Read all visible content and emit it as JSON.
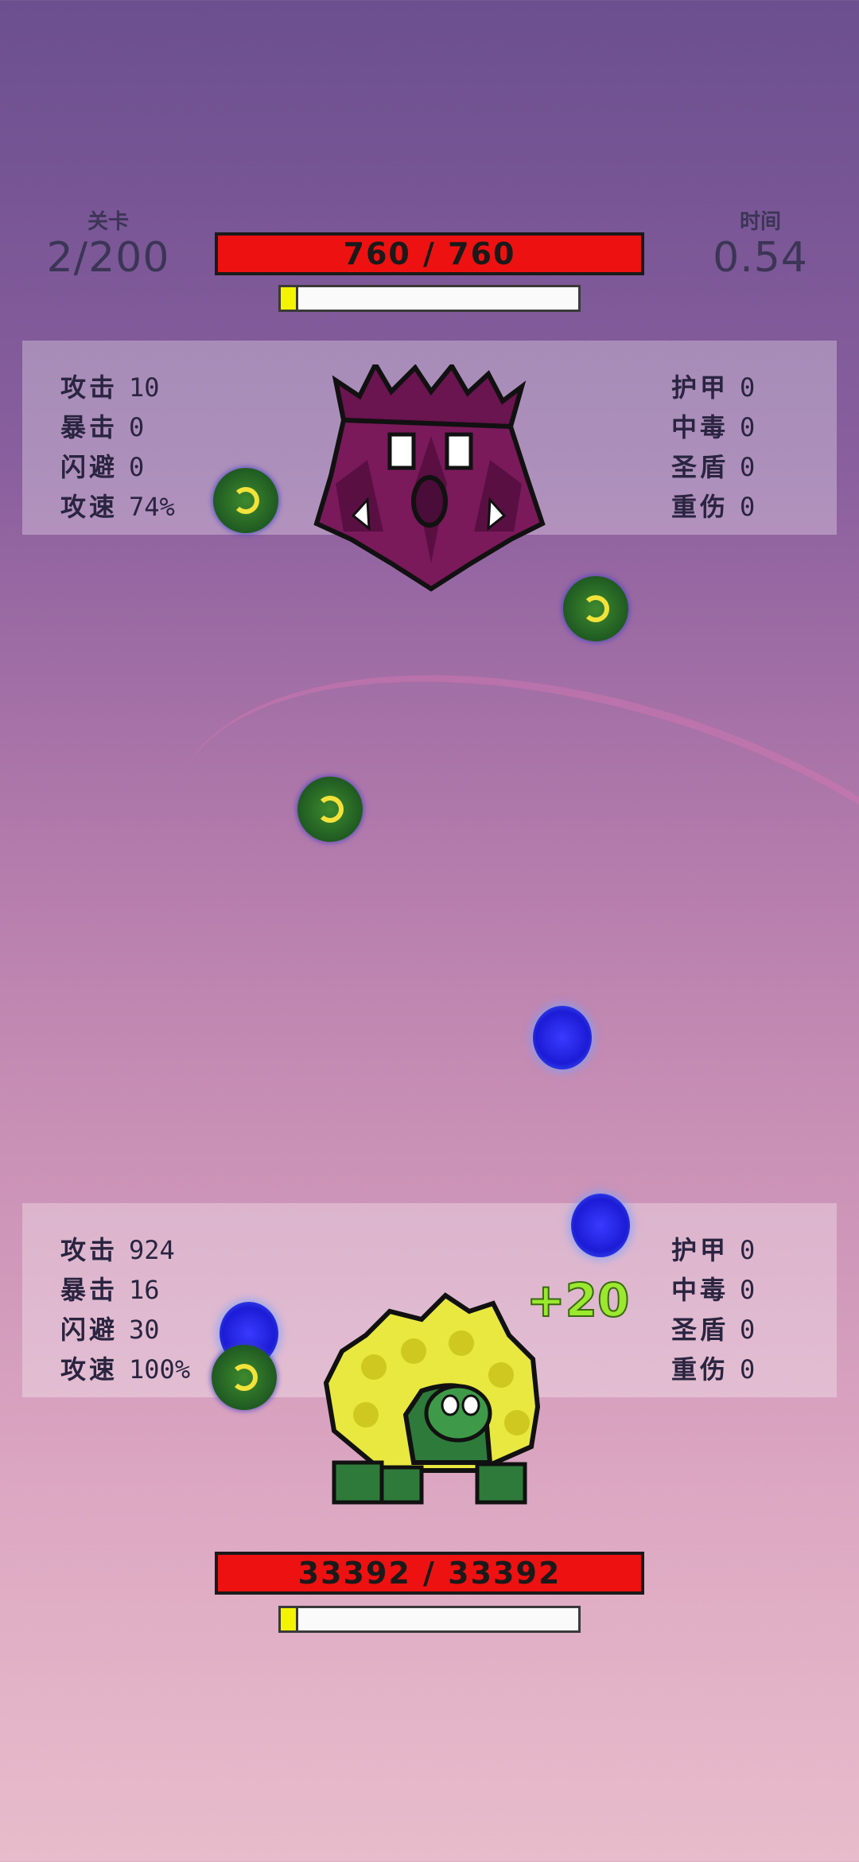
{
  "hud": {
    "level_label": "关卡",
    "level_value": "2/200",
    "time_label": "时间",
    "time_value": "0.54"
  },
  "enemy": {
    "hp_text": "760 / 760",
    "hp_fraction": 1.0,
    "charge_fraction": 0.05,
    "stats_left": [
      {
        "label": "攻击",
        "value": "10"
      },
      {
        "label": "暴击",
        "value": "0"
      },
      {
        "label": "闪避",
        "value": "0"
      },
      {
        "label": "攻速",
        "value": "74%"
      }
    ],
    "stats_right": [
      {
        "label": "护甲",
        "value": "0"
      },
      {
        "label": "中毒",
        "value": "0"
      },
      {
        "label": "圣盾",
        "value": "0"
      },
      {
        "label": "重伤",
        "value": "0"
      }
    ]
  },
  "player": {
    "hp_text": "33392 / 33392",
    "hp_fraction": 1.0,
    "charge_fraction": 0.05,
    "heal_popup": "+20",
    "stats_left": [
      {
        "label": "攻击",
        "value": "924"
      },
      {
        "label": "暴击",
        "value": "16"
      },
      {
        "label": "闪避",
        "value": "30"
      },
      {
        "label": "攻速",
        "value": "100%"
      }
    ],
    "stats_right": [
      {
        "label": "护甲",
        "value": "0"
      },
      {
        "label": "中毒",
        "value": "0"
      },
      {
        "label": "圣盾",
        "value": "0"
      },
      {
        "label": "重伤",
        "value": "0"
      }
    ]
  },
  "colors": {
    "hp_bar": "#ee1111",
    "charge_fill": "#f4f400",
    "enemy_body": "#7a1a5a",
    "player_shell": "#e8e840",
    "player_body": "#2e7a3a"
  },
  "icons": {
    "enemy": "purple-spiked-monster-sprite",
    "player": "yellow-shell-turtle-sprite",
    "green_projectile": "green-orb-icon",
    "blue_projectile": "blue-energy-orb-icon"
  }
}
